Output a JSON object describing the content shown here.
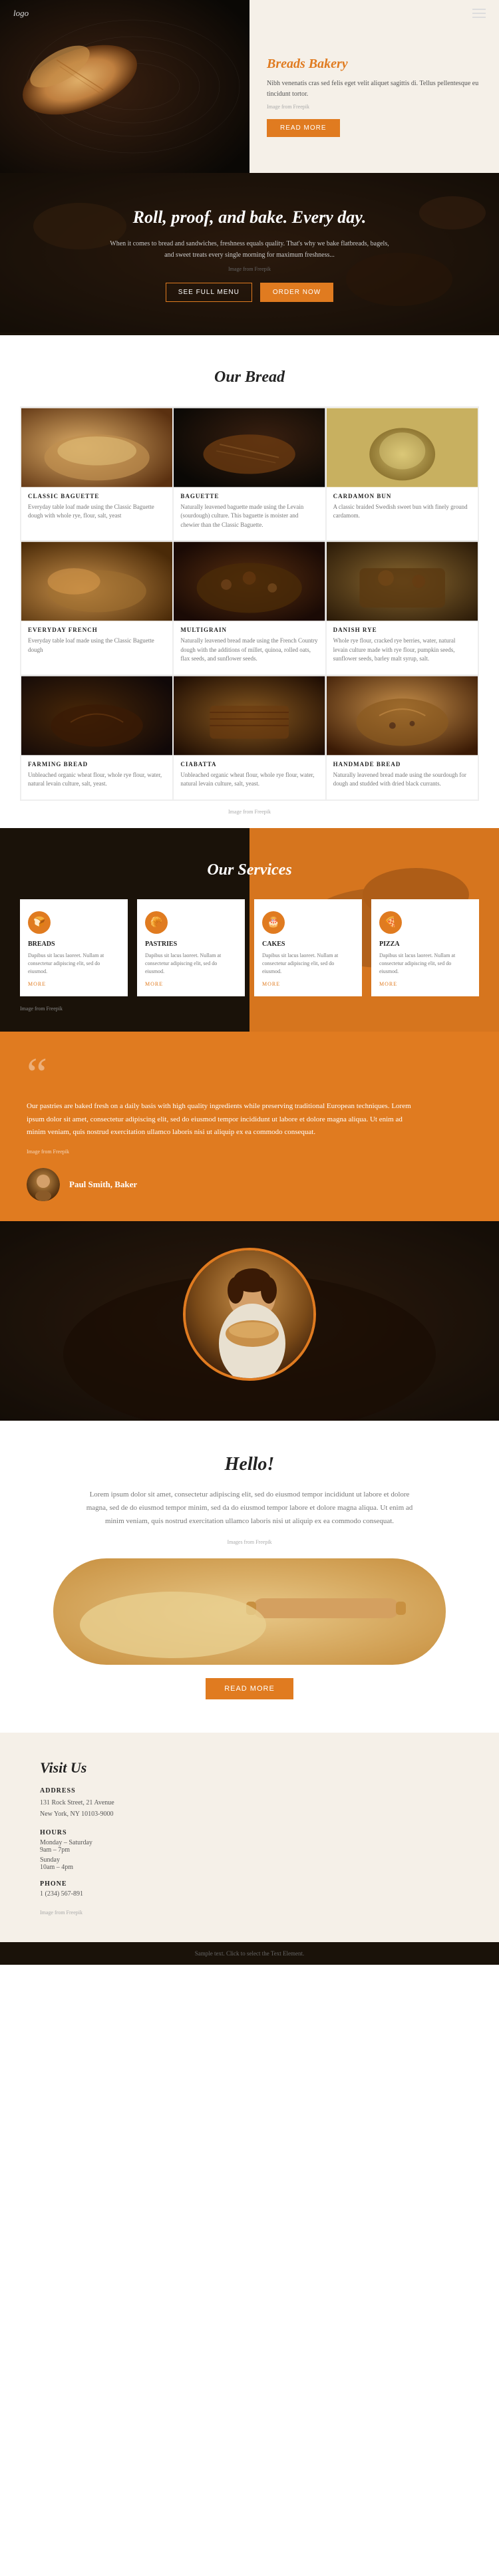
{
  "nav": {
    "logo": "logo",
    "menu_icon": "hamburger-menu"
  },
  "hero": {
    "title": "Breads Bakery",
    "description": "Nibh venenatis cras sed felis eget velit aliquet sagittis di. Tellus pellentesque eu tincidunt tortor.",
    "image_from": "Image from Freepik",
    "read_more": "READ MORE"
  },
  "banner": {
    "title": "Roll, proof, and bake. Every day.",
    "description": "When it comes to bread and sandwiches, freshness equals quality. That's why we bake flatbreads, bagels, and sweet treats every single morning for maximum freshness...",
    "image_from": "Image from Freepik",
    "btn_menu": "SEE FULL MENU",
    "btn_order": "ORDER NOW"
  },
  "our_bread": {
    "section_title": "Our Bread",
    "items": [
      {
        "name": "Classic Baguette",
        "desc": "Everyday table loaf made using the Classic Baguette dough with whole rye, flour, salt, yeast",
        "img_class": "b1"
      },
      {
        "name": "Baguette",
        "desc": "Naturally leavened baguette made using the Levain (sourdough) culture. This baguette is moister and chewier than the Classic Baguette.",
        "img_class": "b2"
      },
      {
        "name": "Cardamon Bun",
        "desc": "A classic braided Swedish sweet bun with finely ground cardamom.",
        "img_class": "b3"
      },
      {
        "name": "Everyday French",
        "desc": "Everyday table loaf made using the Classic Baguette dough",
        "img_class": "b4"
      },
      {
        "name": "Multigrain",
        "desc": "Naturally leavened bread made using the French Country dough with the additions of millet, quinoa, rolled oats, flax seeds, and sunflower seeds.",
        "img_class": "b5"
      },
      {
        "name": "Danish Rye",
        "desc": "Whole rye flour, cracked rye berries, water, natural levain culture made with rye flour, pumpkin seeds, sunflower seeds, barley malt syrup, salt.",
        "img_class": "b6"
      },
      {
        "name": "Farming Bread",
        "desc": "Unbleached organic wheat flour, whole rye flour, water, natural levain culture, salt, yeast.",
        "img_class": "b7"
      },
      {
        "name": "Ciabatta",
        "desc": "Unbleached organic wheat flour, whole rye flour, water, natural levain culture, salt, yeast.",
        "img_class": "b8"
      },
      {
        "name": "Handmade Bread",
        "desc": "Naturally leavened bread made using the sourdough for dough and studded with dried black currants.",
        "img_class": "b9"
      }
    ],
    "image_from": "Image from Freepik"
  },
  "our_services": {
    "section_title": "Our Services",
    "items": [
      {
        "icon": "🍞",
        "name": "Breads",
        "desc": "Dapibus sit lacus laoreet. Nullam at consectetur adipiscing elit, sed do eiusmod.",
        "more": "MORE"
      },
      {
        "icon": "🥐",
        "name": "Pastries",
        "desc": "Dapibus sit lacus laoreet. Nullam at consectetur adipiscing elit, sed do eiusmod.",
        "more": "MORE"
      },
      {
        "icon": "🎂",
        "name": "Cakes",
        "desc": "Dapibus sit lacus laoreet. Nullam at consectetur adipiscing elit, sed do eiusmod.",
        "more": "MORE"
      },
      {
        "icon": "🍕",
        "name": "Pizza",
        "desc": "Dapibus sit lacus laoreet. Nullam at consectetur adipiscing elit, sed do eiusmod.",
        "more": "MORE"
      }
    ],
    "image_from": "Image from Freepik"
  },
  "quote": {
    "mark": "“",
    "text": "Our pastries are baked fresh on a daily basis with high quality ingredients while preserving traditional European techniques. Lorem ipsum dolor sit amet, consectetur adipiscing elit, sed do eiusmod tempor incididunt ut labore et dolore magna aliqua. Ut enim ad minim veniam, quis nostrud exercitation ullamco laboris nisi ut aliquip ex ea commodo consequat.",
    "image_from": "Image from Freepik",
    "author_name": "Paul Smith, Baker",
    "author_title": ""
  },
  "hello": {
    "title": "Hello!",
    "text": "Lorem ipsum dolor sit amet, consectetur adipiscing elit, sed do eiusmod tempor incididunt ut labore et dolore magna, sed de do eiusmod tempor minim, sed da do eiusmod tempor labore et dolore magna aliqua. Ut enim ad minim veniam, quis nostrud exercitation ullamco laboris nisi ut aliquip ex ea commodo consequat.",
    "image_from": "Images from Freepik",
    "read_more": "READ MORE"
  },
  "visit": {
    "title": "Visit Us",
    "address_label": "ADDRESS",
    "address": "131 Rock Street, 21 Avenue\nNew York, NY 10103-9000",
    "hours_label": "HOURS",
    "hours_weekday": "Monday – Saturday",
    "hours_weekday_time": "9am – 7pm",
    "hours_sunday": "Sunday",
    "hours_sunday_time": "10am – 4pm",
    "phone_label": "PHONE",
    "phone": "1 (234) 567-891",
    "image_from": "Image from Freepik"
  },
  "footer": {
    "text": "Sample text. Click to select the Text Element."
  }
}
